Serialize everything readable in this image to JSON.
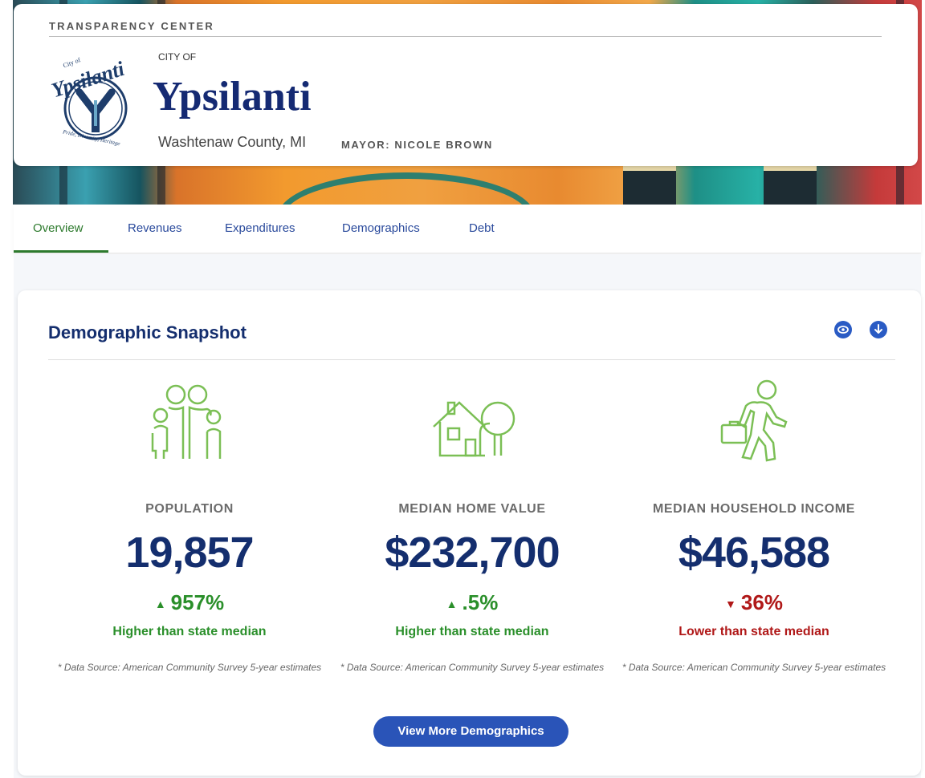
{
  "header": {
    "section_label": "TRANSPARENCY CENTER",
    "city_of": "CITY OF",
    "city_name": "Ypsilanti",
    "county": "Washtenaw County, MI",
    "mayor": "MAYOR: NICOLE BROWN"
  },
  "tabs": [
    {
      "label": "Overview",
      "active": true
    },
    {
      "label": "Revenues",
      "active": false
    },
    {
      "label": "Expenditures",
      "active": false
    },
    {
      "label": "Demographics",
      "active": false
    },
    {
      "label": "Debt",
      "active": false
    }
  ],
  "snapshot": {
    "title": "Demographic Snapshot",
    "actions": [
      "eye-icon",
      "download-icon"
    ],
    "stats": [
      {
        "icon": "family-icon",
        "label": "POPULATION",
        "value": "19,857",
        "change": "957%",
        "direction": "up",
        "note": "Higher than state median",
        "source": "* Data Source: American Community Survey 5-year estimates"
      },
      {
        "icon": "house-tree-icon",
        "label": "MEDIAN HOME VALUE",
        "value": "$232,700",
        "change": ".5%",
        "direction": "up",
        "note": "Higher than state median",
        "source": "* Data Source: American Community Survey 5-year estimates"
      },
      {
        "icon": "walking-briefcase-icon",
        "label": "MEDIAN HOUSEHOLD INCOME",
        "value": "$46,588",
        "change": "36%",
        "direction": "down",
        "note": "Lower than state median",
        "source": "* Data Source: American Community Survey 5-year estimates"
      }
    ],
    "cta_label": "View More Demographics"
  },
  "colors": {
    "navy": "#142e6e",
    "green": "#2a8f2a",
    "red": "#b01818",
    "button": "#2a54b8",
    "icon_green": "#7bbf55"
  },
  "seal_text": [
    "City of",
    "Ypsilanti",
    "Pride, Diversity, Heritage"
  ]
}
